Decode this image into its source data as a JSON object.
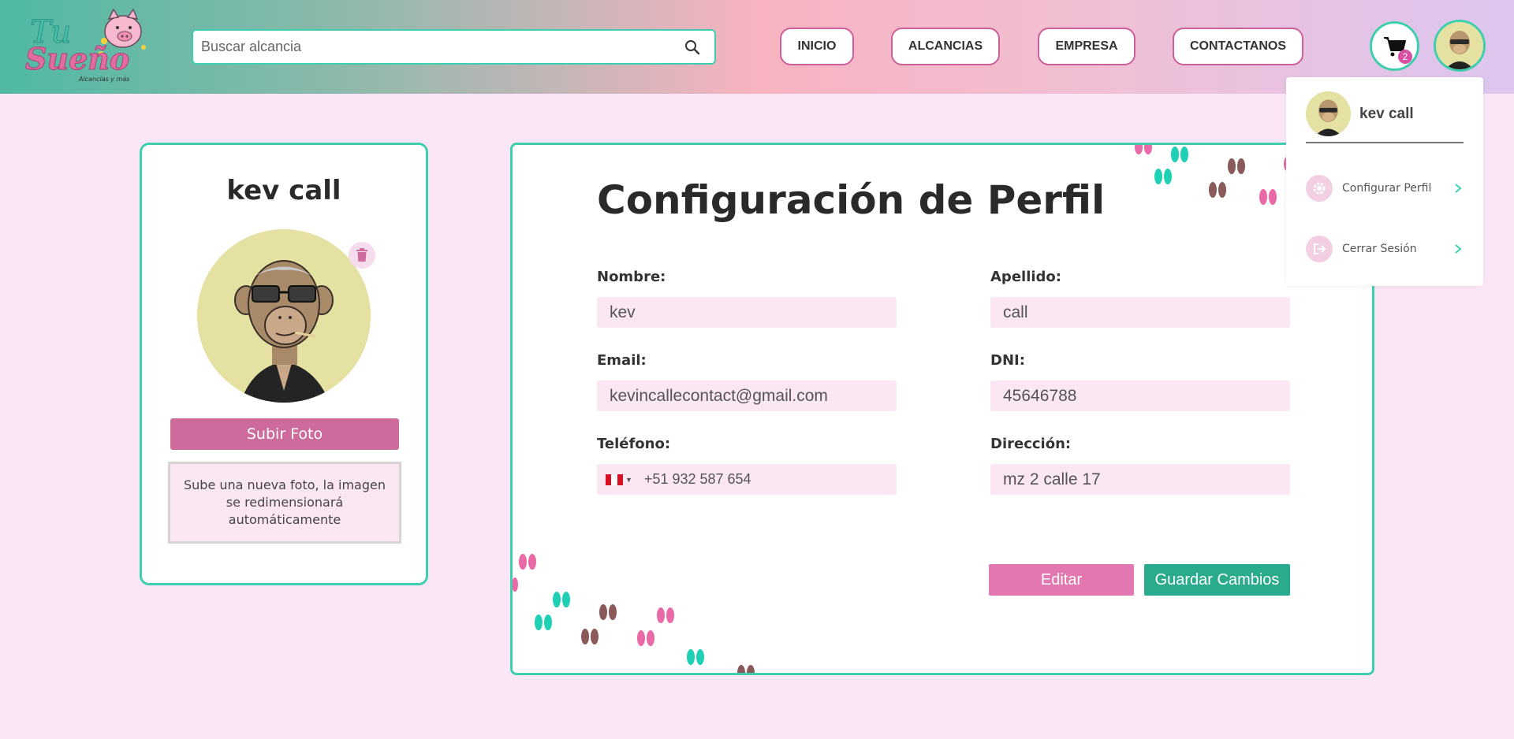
{
  "brand": {
    "logo_line1": "Tu",
    "logo_line2": "Sueño",
    "logo_tagline": "Alcancías y más"
  },
  "search": {
    "placeholder": "Buscar alcancia",
    "icon": "search-icon"
  },
  "nav": {
    "items": [
      {
        "label": "INICIO"
      },
      {
        "label": "ALCANCIAS"
      },
      {
        "label": "EMPRESA"
      },
      {
        "label": "CONTACTANOS"
      }
    ]
  },
  "cart": {
    "icon": "cart-icon",
    "count": "2"
  },
  "profile_card": {
    "name": "kev call",
    "upload_label": "Subir Foto",
    "upload_hint": "Sube una nueva foto, la imagen se redimensionará automáticamente",
    "delete_icon": "trash-icon"
  },
  "form": {
    "title": "Configuración de Perfil",
    "fields": {
      "nombre": {
        "label": "Nombre:",
        "value": "kev"
      },
      "apellido": {
        "label": "Apellido:",
        "value": "call"
      },
      "email": {
        "label": "Email:",
        "value": "kevincallecontact@gmail.com"
      },
      "dni": {
        "label": "DNI:",
        "value": "45646788"
      },
      "telefono": {
        "label": "Teléfono:",
        "value": "+51 932 587 654",
        "flag": "pe-flag-icon"
      },
      "direccion": {
        "label": "Dirección:",
        "value": "mz 2 calle 17"
      }
    },
    "edit_label": "Editar",
    "save_label": "Guardar Cambios"
  },
  "user_menu": {
    "username": "kev call",
    "items": [
      {
        "label": "Configurar Perfil",
        "icon": "gear-icon"
      },
      {
        "label": "Cerrar Sesión",
        "icon": "logout-icon"
      }
    ]
  },
  "colors": {
    "accent_teal": "#3fcfae",
    "accent_pink": "#cd6b9c",
    "background": "#fbe6f7",
    "save_green": "#2bab8e",
    "edit_pink": "#e378b0"
  }
}
